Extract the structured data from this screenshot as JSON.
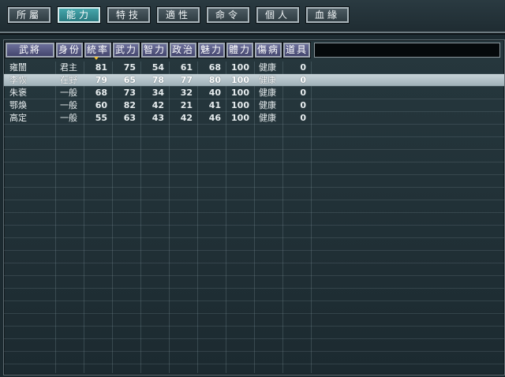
{
  "tabs": [
    {
      "label": "所屬",
      "active": false
    },
    {
      "label": "能力",
      "active": true
    },
    {
      "label": "特技",
      "active": false
    },
    {
      "label": "適性",
      "active": false
    },
    {
      "label": "命令",
      "active": false
    },
    {
      "label": "個人",
      "active": false
    },
    {
      "label": "血緣",
      "active": false
    }
  ],
  "table": {
    "columns": [
      "武將",
      "身份",
      "統率",
      "武力",
      "智力",
      "政治",
      "魅力",
      "體力",
      "傷病",
      "道具"
    ],
    "sorted_column": "統率",
    "rows": [
      {
        "name": "雍闓",
        "status": "君主",
        "lead": "81",
        "war": "75",
        "int": "54",
        "pol": "61",
        "chr": "68",
        "hp": "100",
        "health": "健康",
        "items": "0",
        "selected": false
      },
      {
        "name": "李恢",
        "status": "在野",
        "lead": "79",
        "war": "65",
        "int": "78",
        "pol": "77",
        "chr": "80",
        "hp": "100",
        "health": "健康",
        "items": "0",
        "selected": true
      },
      {
        "name": "朱褒",
        "status": "一般",
        "lead": "68",
        "war": "73",
        "int": "34",
        "pol": "32",
        "chr": "40",
        "hp": "100",
        "health": "健康",
        "items": "0",
        "selected": false
      },
      {
        "name": "鄂煥",
        "status": "一般",
        "lead": "60",
        "war": "82",
        "int": "42",
        "pol": "21",
        "chr": "41",
        "hp": "100",
        "health": "健康",
        "items": "0",
        "selected": false
      },
      {
        "name": "高定",
        "status": "一般",
        "lead": "55",
        "war": "63",
        "int": "43",
        "pol": "42",
        "chr": "46",
        "hp": "100",
        "health": "健康",
        "items": "0",
        "selected": false
      }
    ]
  },
  "colors": {
    "active_tab": "#2a7a80",
    "header": "#44466e",
    "selected_row": "#b4c3c9",
    "sort_marker": "#f2c23a"
  }
}
